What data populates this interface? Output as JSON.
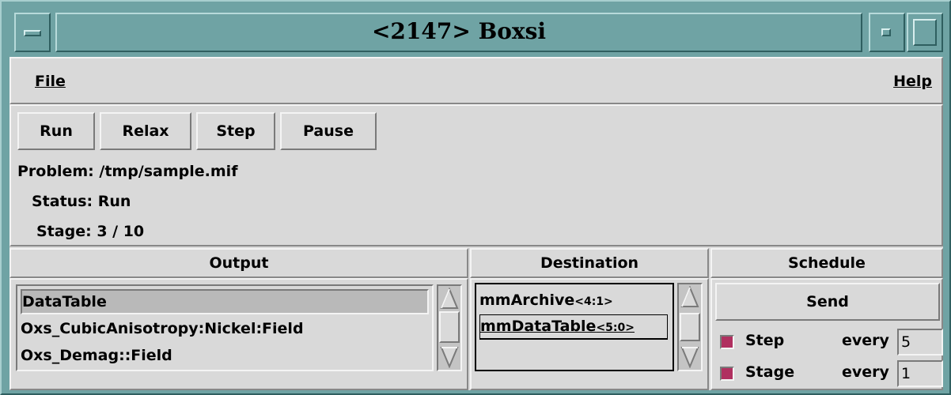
{
  "window": {
    "title": "<2147> Boxsi"
  },
  "menubar": {
    "file_label": "File",
    "help_label": "Help"
  },
  "toolbar": {
    "run_label": "Run",
    "relax_label": "Relax",
    "step_label": "Step",
    "pause_label": "Pause"
  },
  "info": {
    "problem_label": "Problem:",
    "problem_value": "/tmp/sample.mif",
    "status_label": "Status:",
    "status_value": "Run",
    "stage_label": "Stage:",
    "stage_value": "3 / 10"
  },
  "output": {
    "header": "Output",
    "items": [
      "DataTable",
      "Oxs_CubicAnisotropy:Nickel:Field",
      "Oxs_Demag::Field"
    ],
    "selected_index": 0
  },
  "destination": {
    "header": "Destination",
    "items": [
      {
        "name": "mmArchive",
        "id": "<4:1>"
      },
      {
        "name": "mmDataTable",
        "id": "<5:0>"
      }
    ],
    "selected_index": 1
  },
  "schedule": {
    "header": "Schedule",
    "send_label": "Send",
    "rows": [
      {
        "label": "Step",
        "every_label": "every",
        "value": "5",
        "checked": true
      },
      {
        "label": "Stage",
        "every_label": "every",
        "value": "1",
        "checked": true
      }
    ]
  },
  "colors": {
    "frame": "#6fa3a4",
    "background": "#d9d9d9",
    "checkbox": "#b03060"
  }
}
